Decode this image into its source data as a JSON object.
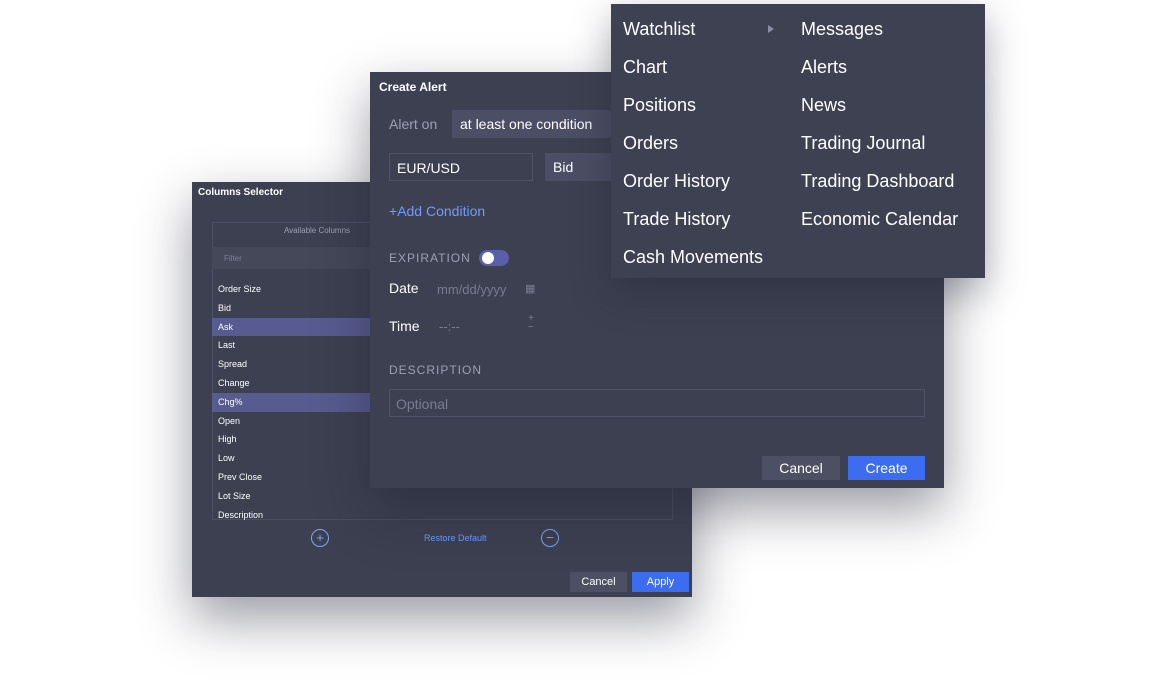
{
  "columns_selector": {
    "title": "Columns Selector",
    "available_header": "Available Columns",
    "filter_placeholder": "Filter",
    "items": [
      {
        "label": "Order Size",
        "selected": false
      },
      {
        "label": "Bid",
        "selected": false
      },
      {
        "label": "Ask",
        "selected": true
      },
      {
        "label": "Last",
        "selected": false
      },
      {
        "label": "Spread",
        "selected": false
      },
      {
        "label": "Change",
        "selected": false
      },
      {
        "label": "Chg%",
        "selected": true
      },
      {
        "label": "Open",
        "selected": false
      },
      {
        "label": "High",
        "selected": false
      },
      {
        "label": "Low",
        "selected": false
      },
      {
        "label": "Prev Close",
        "selected": false
      },
      {
        "label": "Lot Size",
        "selected": false
      },
      {
        "label": "Description",
        "selected": false
      }
    ],
    "add_icon": "plus-circle-icon",
    "remove_icon": "minus-circle-icon",
    "restore_label": "Restore Default",
    "cancel_label": "Cancel",
    "apply_label": "Apply"
  },
  "create_alert": {
    "title": "Create Alert",
    "alert_on_label": "Alert on",
    "condition_mode": "at least one condition",
    "symbol": "EUR/USD",
    "price_field": "Bid",
    "add_condition_label": "Add Condition",
    "expiration_label": "EXPIRATION",
    "expiration_enabled": true,
    "date_label": "Date",
    "date_placeholder": "mm/dd/yyyy",
    "time_label": "Time",
    "time_placeholder": "--:--",
    "description_label": "DESCRIPTION",
    "description_placeholder": "Optional",
    "cancel_label": "Cancel",
    "create_label": "Create"
  },
  "menu": {
    "left": [
      "Watchlist",
      "Chart",
      "Positions",
      "Orders",
      "Order History",
      "Trade History",
      "Cash Movements"
    ],
    "right": [
      "Messages",
      "Alerts",
      "News",
      "Trading Journal",
      "Trading Dashboard",
      "Economic Calendar"
    ]
  },
  "colors": {
    "panel_bg": "#3d4050",
    "accent": "#3c6df0",
    "link": "#6f9cff",
    "selection": "#575b8f"
  }
}
